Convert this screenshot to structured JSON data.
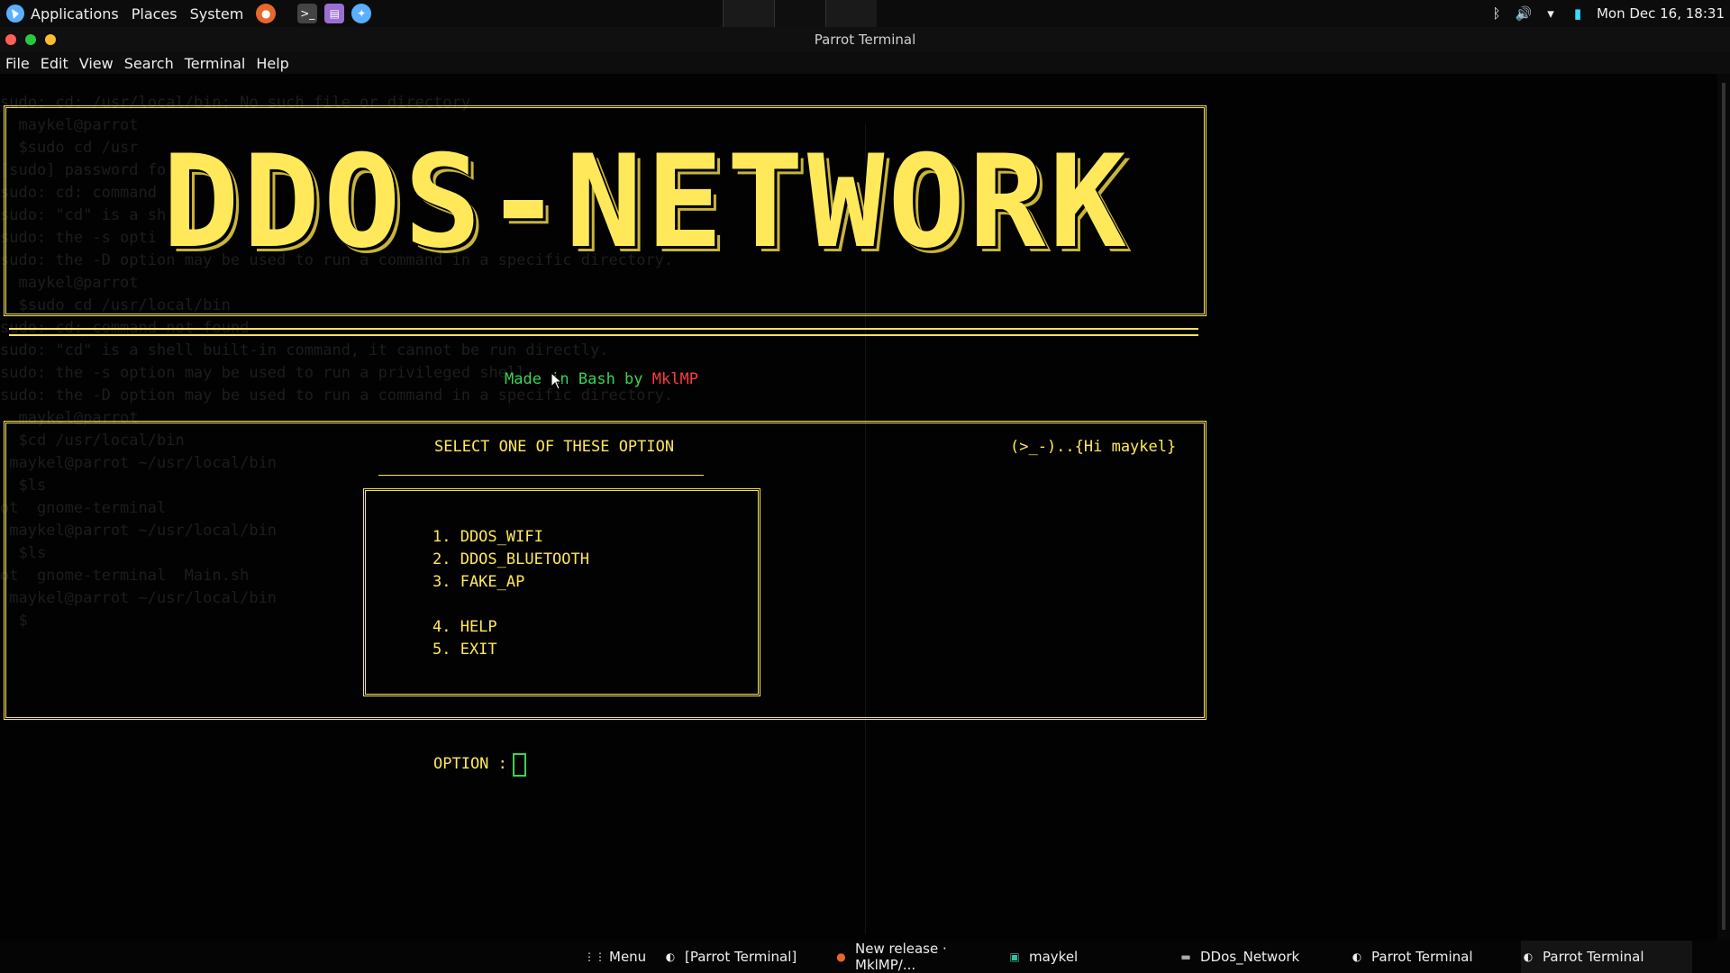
{
  "topbar": {
    "menus": [
      "Applications",
      "Places",
      "System"
    ],
    "datetime": "Mon Dec 16, 18:31"
  },
  "window": {
    "title": "Parrot Terminal"
  },
  "menubar": [
    "File",
    "Edit",
    "View",
    "Search",
    "Terminal",
    "Help"
  ],
  "banner": {
    "title": "DDOS-NETWORK"
  },
  "credit": {
    "prefix": "Made in Bash by ",
    "author": "MklMP"
  },
  "panel": {
    "heading": "SELECT ONE OF THESE OPTION",
    "greeting": "(>_-)..{Hi maykel}",
    "options": [
      "1. DDOS_WIFI",
      "2. DDOS_BLUETOOTH",
      "3. FAKE_AP",
      "4. HELP",
      "5. EXIT"
    ]
  },
  "prompt": {
    "label": "OPTION :"
  },
  "taskbar": {
    "menu": "Menu",
    "items": [
      "[Parrot Terminal]",
      "New release · MklMP/...",
      "maykel",
      "DDos_Network",
      "Parrot Terminal",
      "Parrot Terminal"
    ]
  },
  "colors": {
    "accent": "#ffe95a",
    "green": "#39d353",
    "red": "#ff3c3c",
    "background": "#020202"
  }
}
